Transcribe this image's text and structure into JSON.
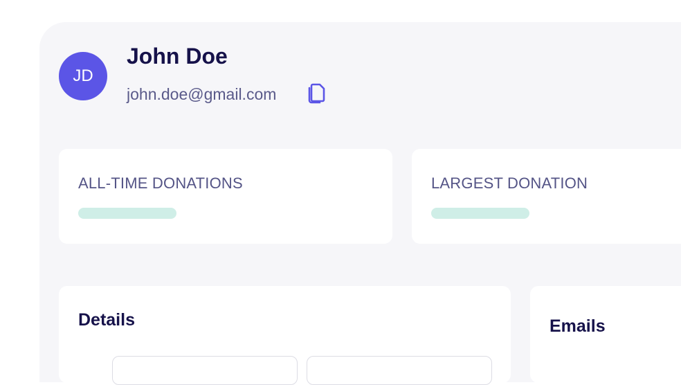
{
  "profile": {
    "initials": "JD",
    "name": "John Doe",
    "email": "john.doe@gmail.com",
    "avatar_color": "#5b55e6",
    "copy_icon": "copy-icon"
  },
  "stats": [
    {
      "label": "ALL-TIME DONATIONS"
    },
    {
      "label": "LARGEST DONATION"
    }
  ],
  "sections": {
    "details_title": "Details",
    "emails_title": "Emails"
  },
  "colors": {
    "heading": "#16124a",
    "muted": "#545486",
    "skeleton": "#cfeee7",
    "panel_bg": "#f6f6f9"
  }
}
